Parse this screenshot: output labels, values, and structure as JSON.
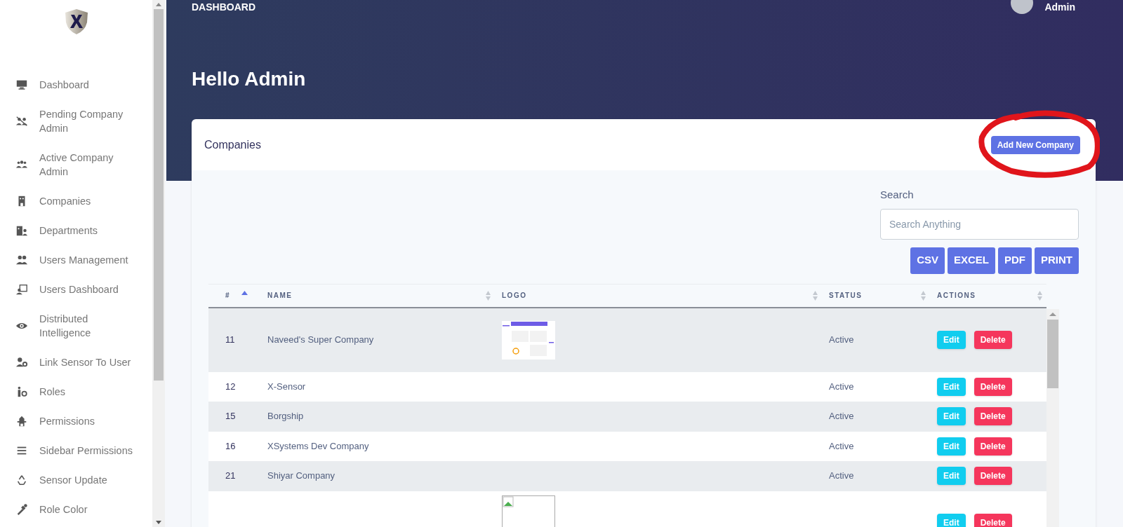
{
  "sidebar": {
    "items": [
      {
        "label": "Dashboard"
      },
      {
        "label": "Pending Company Admin"
      },
      {
        "label": "Active Company Admin"
      },
      {
        "label": "Companies"
      },
      {
        "label": "Departments"
      },
      {
        "label": "Users Management"
      },
      {
        "label": "Users Dashboard"
      },
      {
        "label": "Distributed Intelligence"
      },
      {
        "label": "Link Sensor To User"
      },
      {
        "label": "Roles"
      },
      {
        "label": "Permissions"
      },
      {
        "label": "Sidebar Permissions"
      },
      {
        "label": "Sensor Update"
      },
      {
        "label": "Role Color"
      }
    ]
  },
  "header": {
    "breadcrumb": "DASHBOARD",
    "user": "Admin",
    "greeting": "Hello Admin"
  },
  "card": {
    "title": "Companies",
    "add_button": "Add New Company",
    "search": {
      "label": "Search",
      "placeholder": "Search Anything"
    },
    "export_buttons": [
      "CSV",
      "EXCEL",
      "PDF",
      "PRINT"
    ],
    "table": {
      "columns": [
        {
          "label": "#",
          "sorted": true
        },
        {
          "label": "NAME",
          "sorted": false
        },
        {
          "label": "LOGO",
          "sorted": false
        },
        {
          "label": "STATUS",
          "sorted": false
        },
        {
          "label": "ACTIONS",
          "sorted": false
        }
      ],
      "rows": [
        {
          "id": "11",
          "name": "Naveed's Super Company",
          "logo": {
            "broken": false
          },
          "status": "Active",
          "edit": "Edit",
          "delete": "Delete"
        },
        {
          "id": "12",
          "name": "X-Sensor",
          "status": "Active",
          "edit": "Edit",
          "delete": "Delete"
        },
        {
          "id": "15",
          "name": "Borgship",
          "status": "Active",
          "edit": "Edit",
          "delete": "Delete"
        },
        {
          "id": "16",
          "name": "XSystems Dev Company",
          "status": "Active",
          "edit": "Edit",
          "delete": "Delete"
        },
        {
          "id": "21",
          "name": "Shiyar Company",
          "status": "Active",
          "edit": "Edit",
          "delete": "Delete"
        },
        {
          "id": "",
          "name": "",
          "logo": {
            "broken": true
          },
          "status": "",
          "edit": "Edit",
          "delete": "Delete"
        }
      ]
    }
  }
}
